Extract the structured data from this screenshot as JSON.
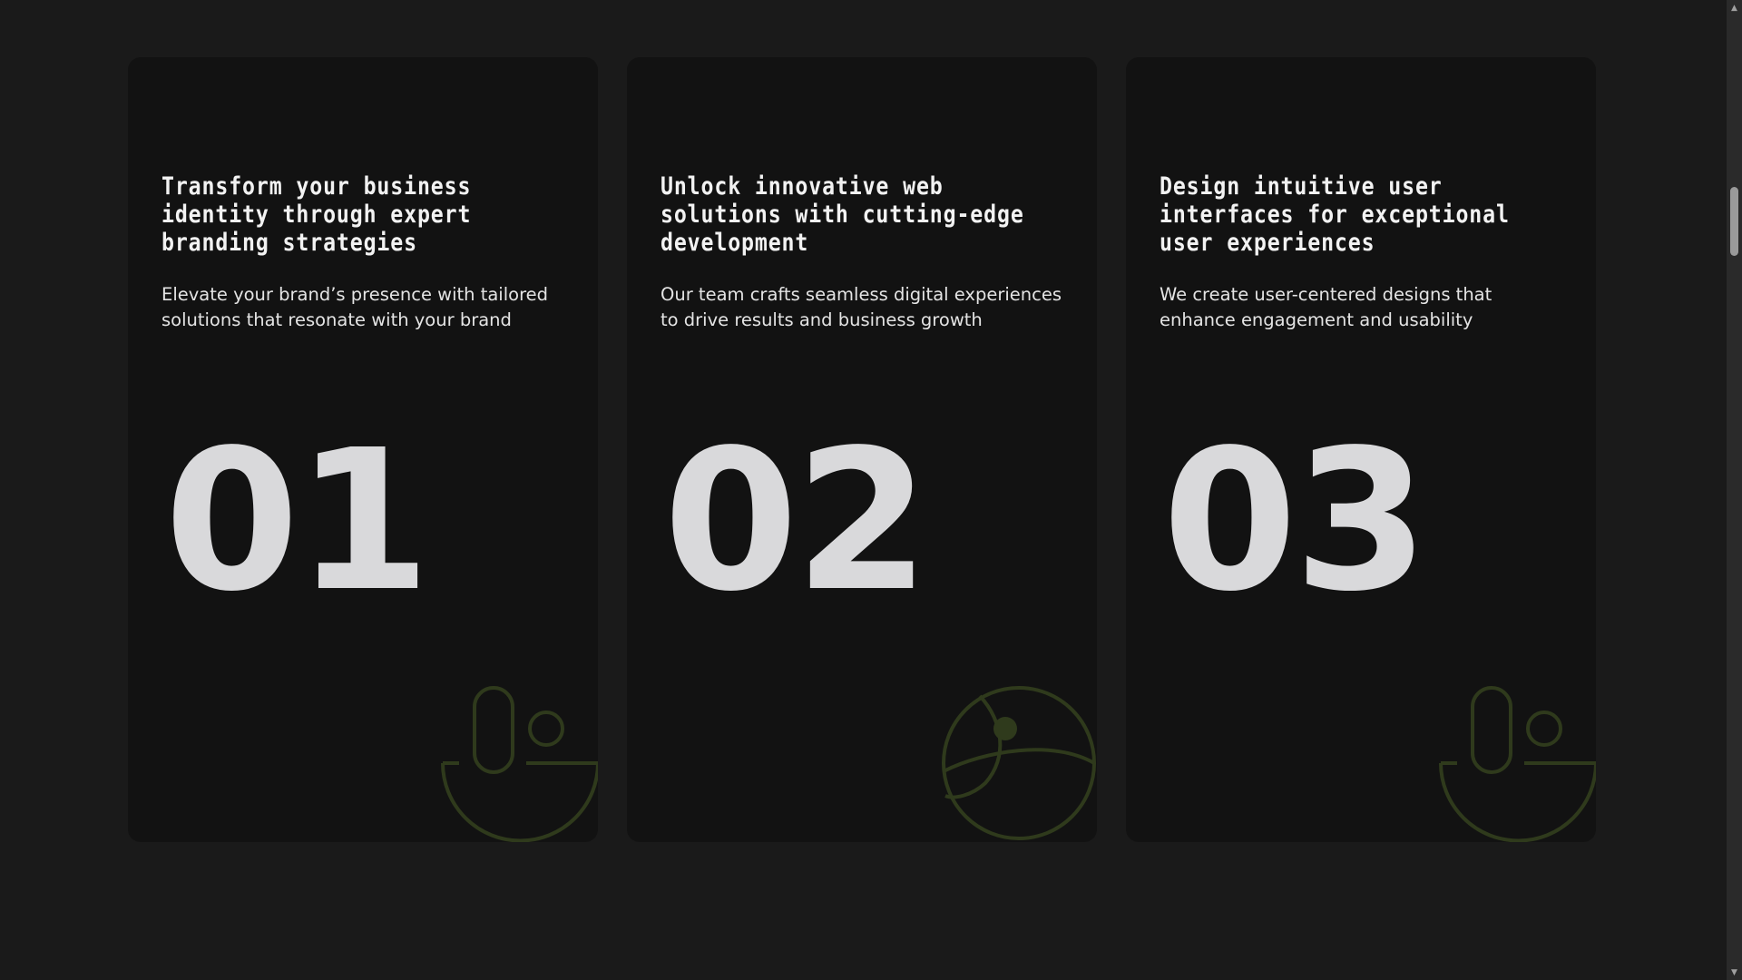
{
  "cards": [
    {
      "title": "Transform your business identity through expert branding strategies",
      "description": "Elevate your brand’s presence with tailored solutions that resonate with your brand",
      "number": "01",
      "icon": "mouse-scroll-icon"
    },
    {
      "title": "Unlock innovative web solutions with cutting-edge development",
      "description": "Our team crafts seamless digital experiences to drive results and business growth",
      "number": "02",
      "icon": "globe-orbit-icon"
    },
    {
      "title": "Design intuitive user interfaces for exceptional user experiences",
      "description": "We create user-centered designs that enhance engagement and usability",
      "number": "03",
      "icon": "mouse-scroll-icon"
    }
  ],
  "colors": {
    "page_background": "#1a1a1a",
    "card_background": "#121212",
    "number_color": "#d9d9db",
    "icon_stroke": "#2f3a1c"
  },
  "scrollbar": {
    "up_arrow": "▲",
    "down_arrow": "▼"
  }
}
